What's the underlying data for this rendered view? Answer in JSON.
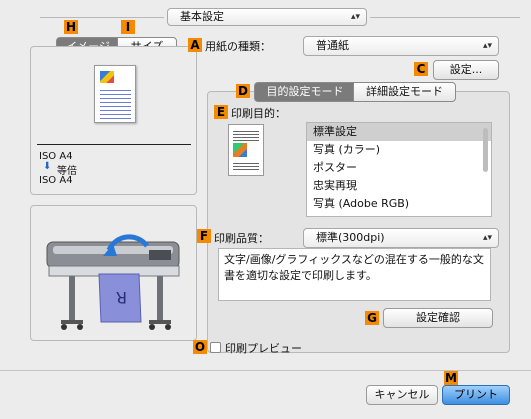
{
  "top_preset": {
    "value": "基本設定"
  },
  "tags": {
    "H": "H",
    "I": "I",
    "A": "A",
    "C": "C",
    "D": "D",
    "E": "E",
    "F": "F",
    "G": "G",
    "O": "O",
    "M": "M"
  },
  "left_tabs": {
    "image": "イメージ",
    "size": "サイズ"
  },
  "paper": {
    "label": "用紙の種類：",
    "value": "普通紙",
    "settings_button": "設定..."
  },
  "size_info": {
    "from": "ISO A4",
    "scale": "等倍",
    "to": "ISO A4"
  },
  "mode_tabs": {
    "purpose": "目的設定モード",
    "advanced": "詳細設定モード"
  },
  "purpose": {
    "label": "印刷目的：",
    "items": [
      "標準設定",
      "写真 (カラー)",
      "ポスター",
      "忠実再現",
      "写真 (Adobe RGB)"
    ],
    "selected_index": 0
  },
  "quality": {
    "label": "印刷品質：",
    "value": "標準(300dpi)"
  },
  "description": {
    "text": "文字/画像/グラフィックスなどの混在する一般的な文書を適切な設定で印刷します。"
  },
  "confirm_button": "設定確認",
  "preview": {
    "label": "印刷プレビュー",
    "checked": false
  },
  "footer": {
    "cancel": "キャンセル",
    "print": "プリント"
  },
  "colors": {
    "accent_tag": "#f58a00",
    "active_segment": "#7b7b7b",
    "print_button": "#5fa5e6"
  }
}
